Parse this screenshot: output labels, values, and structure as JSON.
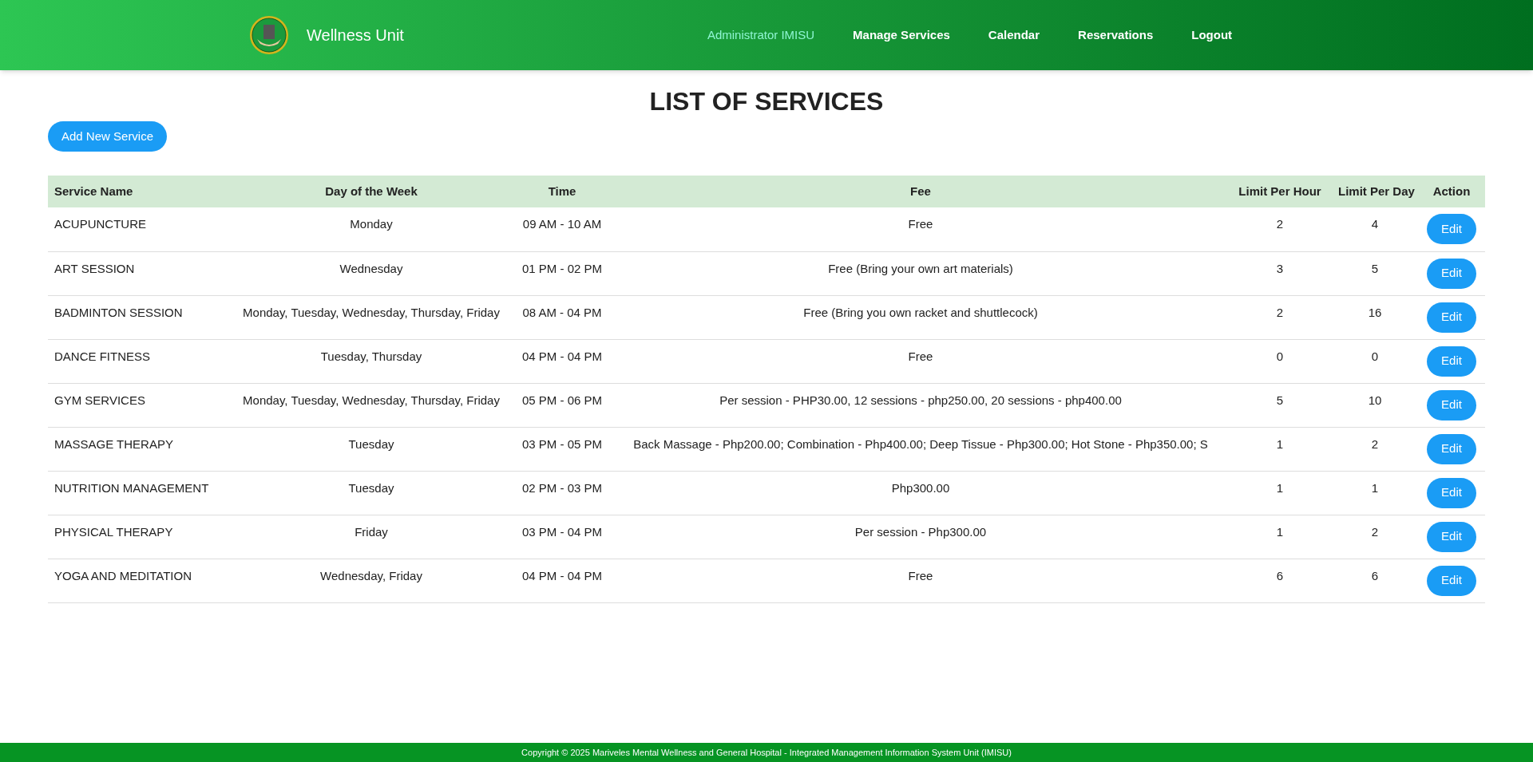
{
  "navbar": {
    "brand": "Wellness Unit",
    "links": [
      {
        "label": "Administrator IMISU",
        "selected": true
      },
      {
        "label": "Manage Services",
        "selected": false
      },
      {
        "label": "Calendar",
        "selected": false
      },
      {
        "label": "Reservations",
        "selected": false
      },
      {
        "label": "Logout",
        "selected": false
      }
    ]
  },
  "page_title": "LIST OF SERVICES",
  "add_button": "Add New Service",
  "table": {
    "columns": [
      "Service Name",
      "Day of the Week",
      "Time",
      "Fee",
      "Limit Per Hour",
      "Limit Per Day",
      "Action"
    ],
    "rows": [
      {
        "name": "ACUPUNCTURE",
        "days": "Monday",
        "time": "09 AM - 10 AM",
        "fee": "Free",
        "per_hour": "2",
        "per_day": "4",
        "action": "Edit"
      },
      {
        "name": "ART SESSION",
        "days": "Wednesday",
        "time": "01 PM - 02 PM",
        "fee": "Free (Bring your own art materials)",
        "per_hour": "3",
        "per_day": "5",
        "action": "Edit"
      },
      {
        "name": "BADMINTON SESSION",
        "days": "Monday, Tuesday, Wednesday, Thursday, Friday",
        "time": "08 AM - 04 PM",
        "fee": "Free (Bring you own racket and shuttlecock)",
        "per_hour": "2",
        "per_day": "16",
        "action": "Edit"
      },
      {
        "name": "DANCE FITNESS",
        "days": "Tuesday, Thursday",
        "time": "04 PM - 04 PM",
        "fee": "Free",
        "per_hour": "0",
        "per_day": "0",
        "action": "Edit"
      },
      {
        "name": "GYM SERVICES",
        "days": "Monday, Tuesday, Wednesday, Thursday, Friday",
        "time": "05 PM - 06 PM",
        "fee": "Per session - PHP30.00, 12 sessions - php250.00, 20 sessions - php400.00",
        "per_hour": "5",
        "per_day": "10",
        "action": "Edit"
      },
      {
        "name": "MASSAGE THERAPY",
        "days": "Tuesday",
        "time": "03 PM - 05 PM",
        "fee": "Back Massage - Php200.00; Combination - Php400.00; Deep Tissue - Php300.00; Hot Stone - Php350.00; S",
        "per_hour": "1",
        "per_day": "2",
        "action": "Edit"
      },
      {
        "name": "NUTRITION MANAGEMENT",
        "days": "Tuesday",
        "time": "02 PM - 03 PM",
        "fee": "Php300.00",
        "per_hour": "1",
        "per_day": "1",
        "action": "Edit"
      },
      {
        "name": "PHYSICAL THERAPY",
        "days": "Friday",
        "time": "03 PM - 04 PM",
        "fee": "Per session - Php300.00",
        "per_hour": "1",
        "per_day": "2",
        "action": "Edit"
      },
      {
        "name": "YOGA AND MEDITATION",
        "days": "Wednesday, Friday",
        "time": "04 PM - 04 PM",
        "fee": "Free",
        "per_hour": "6",
        "per_day": "6",
        "action": "Edit"
      }
    ]
  },
  "footer": "Copyright © 2025 Mariveles Mental Wellness and General Hospital - Integrated Management Information System Unit (IMISU)"
}
